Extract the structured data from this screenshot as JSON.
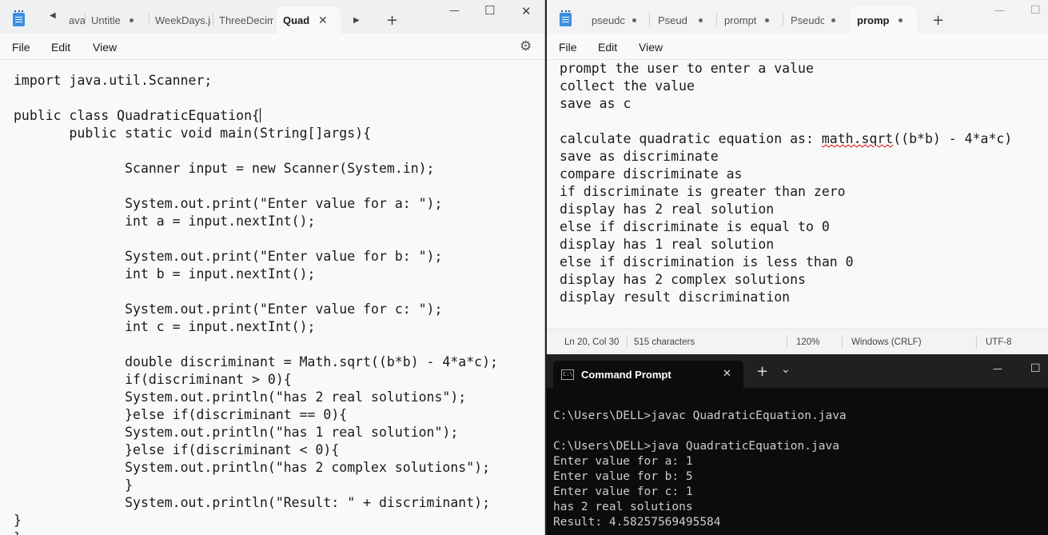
{
  "left_notepad": {
    "tabs": [
      {
        "label": "ava"
      },
      {
        "label": "Untitle"
      },
      {
        "label": "WeekDays.ja"
      },
      {
        "label": "ThreeDecim"
      },
      {
        "label": "Quad"
      }
    ],
    "icons": {
      "left_arrow": "◀",
      "right_arrow": "▶",
      "new_tab": "+",
      "close_tab": "✕",
      "minimize": "—",
      "maximize": "☐",
      "close": "✕",
      "settings": "⚙"
    },
    "menu": {
      "file": "File",
      "edit": "Edit",
      "view": "View"
    },
    "code_lines": [
      "import java.util.Scanner;",
      "",
      "public class QuadraticEquation{",
      "       public static void main(String[]args){",
      "",
      "              Scanner input = new Scanner(System.in);",
      "",
      "              System.out.print(\"Enter value for a: \");",
      "              int a = input.nextInt();",
      "",
      "              System.out.print(\"Enter value for b: \");",
      "              int b = input.nextInt();",
      "",
      "              System.out.print(\"Enter value for c: \");",
      "              int c = input.nextInt();",
      "",
      "              double discriminant = Math.sqrt((b*b) - 4*a*c);",
      "              if(discriminant > 0){",
      "              System.out.println(\"has 2 real solutions\");",
      "              }else if(discriminant == 0){",
      "              System.out.println(\"has 1 real solution\");",
      "              }else if(discriminant < 0){",
      "              System.out.println(\"has 2 complex solutions\");",
      "              }",
      "              System.out.println(\"Result: \" + discriminant);",
      "}",
      "}"
    ]
  },
  "right_notepad": {
    "tabs": [
      {
        "label": "pseudc"
      },
      {
        "label": "Pseudc"
      },
      {
        "label": "prompt"
      },
      {
        "label": "Pseudc"
      },
      {
        "label": "promp"
      }
    ],
    "icons": {
      "new_tab": "+",
      "minimize": "—",
      "maximize": "☐"
    },
    "menu": {
      "file": "File",
      "edit": "Edit",
      "view": "View"
    },
    "text_lines": [
      "prompt the user to enter a value",
      "collect the value",
      "save as c",
      "",
      "calculate quadratic equation as: math.sqrt((b*b) - 4*a*c)",
      "save as discriminate",
      "compare discriminate as",
      "if discriminate is greater than zero",
      "display has 2 real solution",
      "else if discriminate is equal to 0",
      "display has 1 real solution",
      "else if discrimination is less than 0",
      "display has 2 complex solutions",
      "display result discrimination"
    ],
    "status": {
      "position": "Ln 20, Col 30",
      "characters": "515 characters",
      "zoom": "120%",
      "line_ending": "Windows (CRLF)",
      "encoding": "UTF-8"
    }
  },
  "terminal": {
    "tab_title": "Command Prompt",
    "icon_text": "C:\\",
    "icons": {
      "close_tab": "✕",
      "new_tab": "+",
      "dropdown": "⌄",
      "minimize": "—",
      "maximize": "☐"
    },
    "lines": [
      "C:\\Users\\DELL>javac QuadraticEquation.java",
      "",
      "C:\\Users\\DELL>java QuadraticEquation.java",
      "Enter value for a: 1",
      "Enter value for b: 5",
      "Enter value for c: 1",
      "has 2 real solutions",
      "Result: 4.58257569495584"
    ]
  }
}
